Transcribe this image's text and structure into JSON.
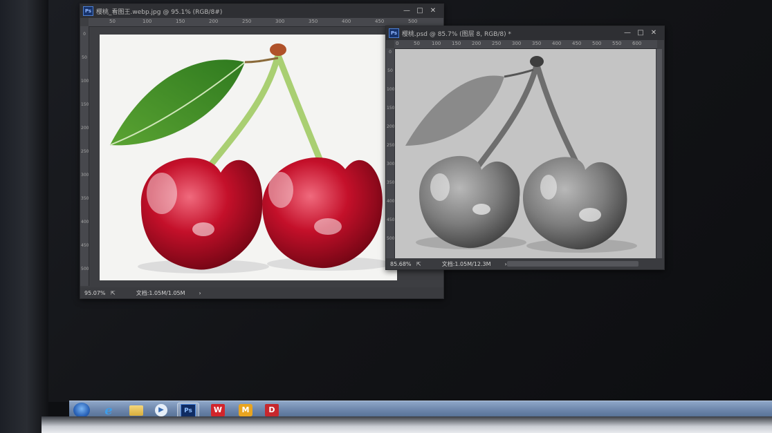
{
  "window_left": {
    "title": "樱桃_看图王.webp.jpg @ 95.1% (RGB/8#)",
    "zoom": "95.07%",
    "doc_info": "文档:1.05M/1.05M",
    "ruler_h": [
      "50",
      "100",
      "150",
      "200",
      "250",
      "300",
      "350",
      "400",
      "450",
      "500"
    ],
    "ruler_v": [
      "0",
      "50",
      "100",
      "150",
      "200",
      "250",
      "300",
      "350",
      "400",
      "450",
      "500"
    ]
  },
  "window_right": {
    "title": "樱桃.psd @ 85.7% (图层 8, RGB/8) *",
    "zoom": "85.68%",
    "doc_info": "文档:1.05M/12.3M",
    "ruler_h": [
      "0",
      "50",
      "100",
      "150",
      "200",
      "250",
      "300",
      "350",
      "400",
      "450",
      "500",
      "550",
      "600"
    ],
    "ruler_v": [
      "0",
      "50",
      "100",
      "150",
      "200",
      "250",
      "300",
      "350",
      "400",
      "450",
      "500"
    ]
  },
  "window_controls": {
    "minimize": "—",
    "restore": "□",
    "close": "✕"
  },
  "status_arrow": "›",
  "taskbar": {
    "ps_label": "Ps",
    "wps_label": "W",
    "yellow_label": "M",
    "red_label": "D"
  },
  "colors": {
    "cherry_red": "#c4102a",
    "leaf_green": "#3f8a25",
    "ps_panel": "#3d3e42",
    "taskbar_blue": "#6f88ad"
  }
}
